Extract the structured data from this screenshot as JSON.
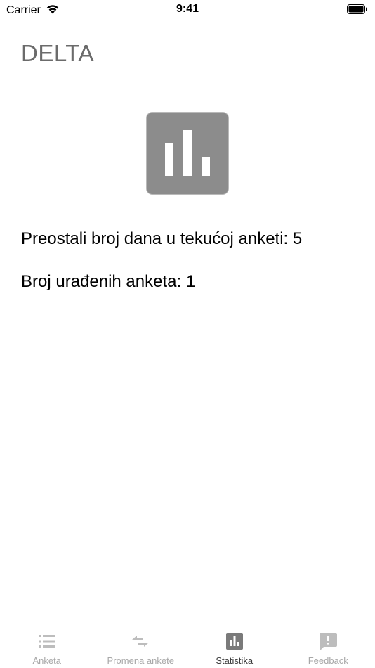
{
  "status_bar": {
    "carrier": "Carrier",
    "time": "9:41"
  },
  "header": {
    "title": "DELTA"
  },
  "stats": {
    "icon": "bar-chart-icon",
    "remaining_days_text": "Preostali broj dana u tekućoj anketi: 5",
    "completed_surveys_text": "Broj urađenih anketa: 1"
  },
  "tab_bar": {
    "tabs": [
      {
        "label": "Anketa",
        "icon": "list-icon",
        "active": false
      },
      {
        "label": "Promena ankete",
        "icon": "swap-arrows-icon",
        "active": false
      },
      {
        "label": "Statistika",
        "icon": "bar-chart-icon",
        "active": true
      },
      {
        "label": "Feedback",
        "icon": "feedback-icon",
        "active": false
      }
    ]
  },
  "colors": {
    "title_gray": "#6b6b6b",
    "icon_card": "#8c8c8c",
    "tab_inactive": "#a8a8a8",
    "tab_active": "#3b3b3b"
  }
}
